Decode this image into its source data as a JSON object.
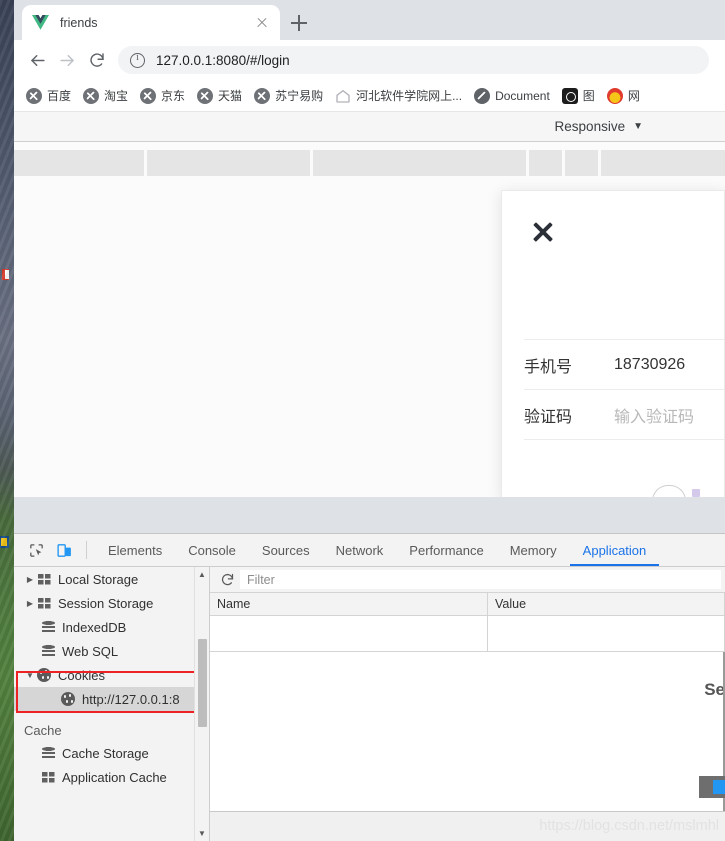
{
  "browser": {
    "tab": {
      "title": "friends",
      "favicon": "vue-logo-icon",
      "close_icon": "close-icon"
    },
    "new_tab_icon": "plus-icon",
    "nav": {
      "back_icon": "back-arrow-icon",
      "forward_icon": "forward-arrow-icon",
      "reload_icon": "reload-icon",
      "security_icon": "info-circle-icon",
      "url": "127.0.0.1:8080/#/login"
    },
    "bookmarks": [
      {
        "label": "百度",
        "icon": "globe-icon"
      },
      {
        "label": "淘宝",
        "icon": "globe-icon"
      },
      {
        "label": "京东",
        "icon": "globe-icon"
      },
      {
        "label": "天猫",
        "icon": "globe-icon"
      },
      {
        "label": "苏宁易购",
        "icon": "globe-icon"
      },
      {
        "label": "河北软件学院网上...",
        "icon": "home-icon"
      },
      {
        "label": "Document",
        "icon": "globe-dark-icon"
      },
      {
        "label": "图",
        "icon": "dark-circle-icon"
      },
      {
        "label": "网",
        "icon": "red-badge-icon"
      }
    ]
  },
  "device_toolbar": {
    "label": "Responsive",
    "caret": "▼"
  },
  "page": {
    "modal": {
      "close_icon": "close-x-icon",
      "rows": [
        {
          "label": "手机号",
          "value": "18730926",
          "is_placeholder": false
        },
        {
          "label": "验证码",
          "value": "输入验证码",
          "is_placeholder": true
        }
      ]
    }
  },
  "devtools": {
    "inspect_icon": "inspect-cursor-icon",
    "device_icon": "device-toolbar-icon",
    "tabs": [
      {
        "label": "Elements",
        "active": false
      },
      {
        "label": "Console",
        "active": false
      },
      {
        "label": "Sources",
        "active": false
      },
      {
        "label": "Network",
        "active": false
      },
      {
        "label": "Performance",
        "active": false
      },
      {
        "label": "Memory",
        "active": false
      },
      {
        "label": "Application",
        "active": true
      }
    ],
    "sidebar": {
      "items": [
        {
          "label": "Local Storage",
          "icon": "grid-icon",
          "twisty": "▶",
          "indent": 0,
          "selected": false
        },
        {
          "label": "Session Storage",
          "icon": "grid-icon",
          "twisty": "▶",
          "indent": 0,
          "selected": false
        },
        {
          "label": "IndexedDB",
          "icon": "database-icon",
          "twisty": "",
          "indent": 1,
          "selected": false
        },
        {
          "label": "Web SQL",
          "icon": "database-icon",
          "twisty": "",
          "indent": 1,
          "selected": false
        },
        {
          "label": "Cookies",
          "icon": "cookie-icon",
          "twisty": "▼",
          "indent": 0,
          "selected": false
        },
        {
          "label": "http://127.0.0.1:8",
          "icon": "cookie-icon",
          "twisty": "",
          "indent": 2,
          "selected": true
        }
      ],
      "section_label": "Cache",
      "cache_items": [
        {
          "label": "Cache Storage",
          "icon": "database-icon",
          "indent": 1
        },
        {
          "label": "Application Cache",
          "icon": "grid-icon",
          "indent": 1
        }
      ],
      "scroll_up_icon": "▲",
      "scroll_down_icon": "▼"
    },
    "cookies_pane": {
      "refresh_icon": "refresh-icon",
      "filter_placeholder": "Filter",
      "filter_value": "",
      "columns": [
        "Name",
        "Value"
      ],
      "rows": [
        {
          "Name": "",
          "Value": ""
        }
      ],
      "overlay_text": "Se"
    },
    "watermark": "https://blog.csdn.net/mslmhl"
  }
}
